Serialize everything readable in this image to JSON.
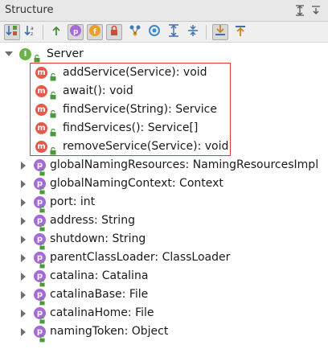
{
  "panel": {
    "title": "Structure"
  },
  "toolbar": {
    "buttons": [
      {
        "name": "sort-by-visibility",
        "icon": "sort-visibility-icon",
        "active": true
      },
      {
        "name": "sort-alphabetically",
        "icon": "sort-alpha-icon",
        "active": false
      },
      {
        "name": "show-inherited",
        "icon": "inherited-icon",
        "active": false
      },
      {
        "name": "show-properties",
        "icon": "property-icon",
        "active": true
      },
      {
        "name": "show-fields",
        "icon": "field-icon",
        "active": true
      },
      {
        "name": "show-non-public",
        "icon": "lock-icon",
        "active": true
      },
      {
        "name": "group-methods",
        "icon": "group-icon",
        "active": false
      },
      {
        "name": "show-anonymous",
        "icon": "anonymous-icon",
        "active": false
      },
      {
        "name": "expand-all",
        "icon": "expand-all-icon",
        "active": false
      },
      {
        "name": "collapse-all",
        "icon": "collapse-all-icon",
        "active": false
      },
      {
        "name": "autoscroll-to-source",
        "icon": "autoscroll-to-source-icon",
        "active": true
      },
      {
        "name": "autoscroll-from-source",
        "icon": "autoscroll-from-source-icon",
        "active": false
      }
    ]
  },
  "tree": {
    "root": {
      "label": "Server",
      "kind": "interface",
      "badge": "I"
    },
    "methods": [
      {
        "label": "addService(Service): void",
        "badge": "m"
      },
      {
        "label": "await(): void",
        "badge": "m"
      },
      {
        "label": "findService(String): Service",
        "badge": "m"
      },
      {
        "label": "findServices(): Service[]",
        "badge": "m"
      },
      {
        "label": "removeService(Service): void",
        "badge": "m"
      }
    ],
    "properties": [
      {
        "label": "globalNamingResources: NamingResourcesImpl",
        "badge": "p"
      },
      {
        "label": "globalNamingContext: Context",
        "badge": "p"
      },
      {
        "label": "port: int",
        "badge": "p"
      },
      {
        "label": "address: String",
        "badge": "p"
      },
      {
        "label": "shutdown: String",
        "badge": "p"
      },
      {
        "label": "parentClassLoader: ClassLoader",
        "badge": "p"
      },
      {
        "label": "catalina: Catalina",
        "badge": "p"
      },
      {
        "label": "catalinaBase: File",
        "badge": "p"
      },
      {
        "label": "catalinaHome: File",
        "badge": "p"
      },
      {
        "label": "namingToken: Object",
        "badge": "p"
      }
    ]
  },
  "colors": {
    "method_badge": "#e35a4a",
    "property_badge": "#a56ad8",
    "interface_badge": "#6bb24a",
    "highlight_border": "#e23a3a",
    "lock_green": "#4a9a3a"
  }
}
